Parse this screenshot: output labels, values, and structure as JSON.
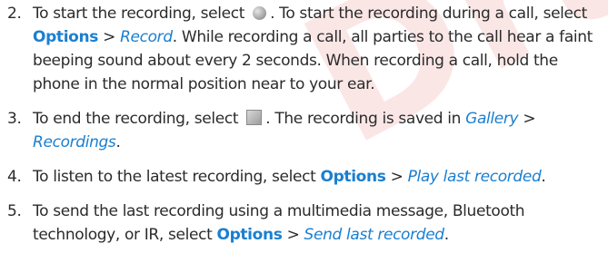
{
  "watermark": "Draft",
  "steps": [
    {
      "num": "2.",
      "p1": "To start the recording, select",
      "icon1": "record-icon",
      "p2": ". To start the recording during a call, select",
      "kw1": "Options",
      "sep1": ">",
      "it1": "Record",
      "p3": ". While recording a call, all parties to the call hear a faint beeping sound about every 2 seconds. When recording a call, hold the phone in the normal position near to your ear."
    },
    {
      "num": "3.",
      "p1": "To end the recording, select",
      "icon1": "stop-icon",
      "p2": ". The recording is saved in",
      "it1": "Gallery",
      "sep1": ">",
      "it2": "Recordings",
      "p3": "."
    },
    {
      "num": "4.",
      "p1": "To listen to the latest recording, select",
      "kw1": "Options",
      "sep1": ">",
      "it1": "Play last recorded",
      "p2": "."
    },
    {
      "num": "5.",
      "p1": "To send the last recording using a multimedia message, Bluetooth technology, or IR, select",
      "kw1": "Options",
      "sep1": ">",
      "it1": "Send last recorded",
      "p2": "."
    }
  ]
}
